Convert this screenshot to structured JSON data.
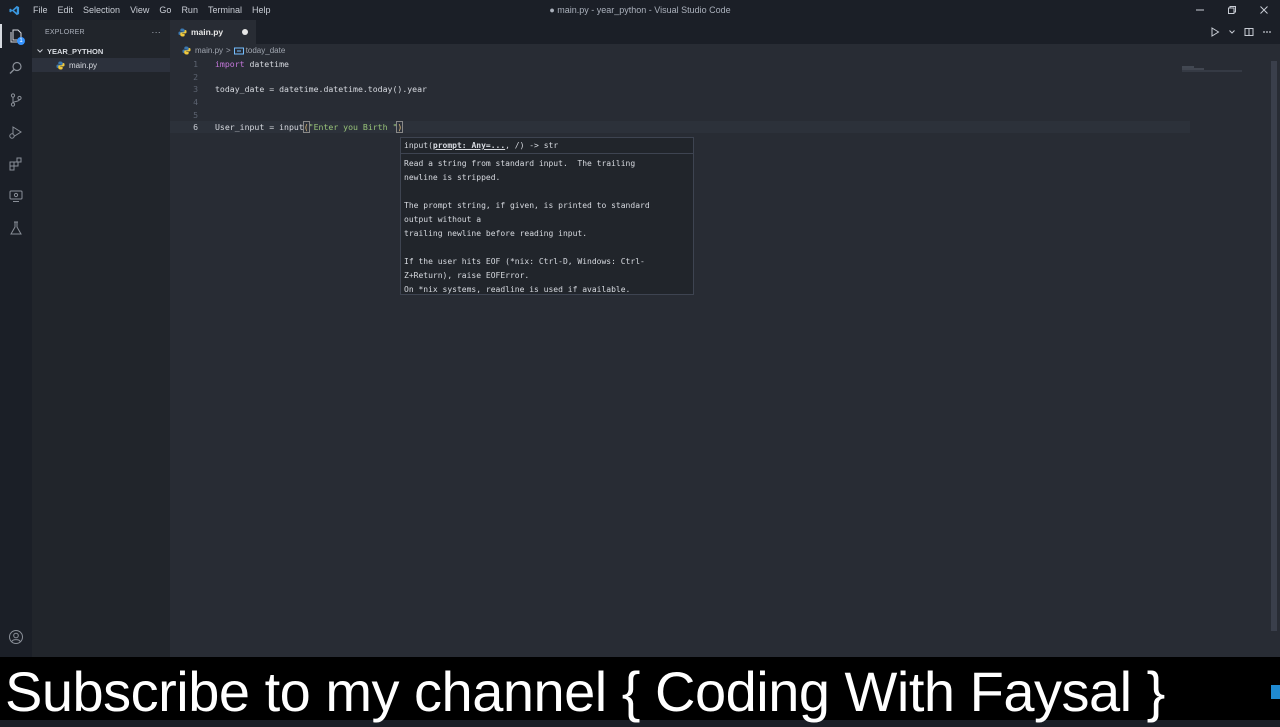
{
  "menu": [
    "File",
    "Edit",
    "Selection",
    "View",
    "Go",
    "Run",
    "Terminal",
    "Help"
  ],
  "window_title": "● main.py - year_python - Visual Studio Code",
  "explorer": {
    "header": "EXPLORER",
    "more": "···",
    "folder": "YEAR_PYTHON",
    "file": "main.py"
  },
  "tab": {
    "label": "main.py"
  },
  "breadcrumb": {
    "file": "main.py",
    "separator": ">",
    "symbol": "today_date"
  },
  "activity_badge": "1",
  "code": {
    "lines": [
      {
        "n": "1"
      },
      {
        "n": "2"
      },
      {
        "n": "3"
      },
      {
        "n": "4"
      },
      {
        "n": "5"
      },
      {
        "n": "6"
      }
    ],
    "line1_kw": "import",
    "line1_rest": " datetime",
    "line3": "today_date = datetime.datetime.today().year",
    "line6_a": "User_input = input",
    "line6_paren_open": "(",
    "line6_str": "\"Enter you Birth \"",
    "line6_paren_close": ")"
  },
  "hover": {
    "sig_pre": "input(",
    "sig_param": "prompt: Any=...",
    "sig_post": ", /) -> str",
    "doc": "Read a string from standard input.  The trailing\nnewline is stripped.\n\nThe prompt string, if given, is printed to standard\noutput without a\ntrailing newline before reading input.\n\nIf the user hits EOF (*nix: Ctrl-D, Windows: Ctrl-\nZ+Return), raise EOFError.\nOn *nix systems, readline is used if available."
  },
  "banner": "Subscribe to my channel { Coding With Faysal }",
  "colors": {
    "accent": "#3794ff",
    "keyword": "#c678dd",
    "string": "#98c379",
    "editor_bg": "#282c34"
  }
}
